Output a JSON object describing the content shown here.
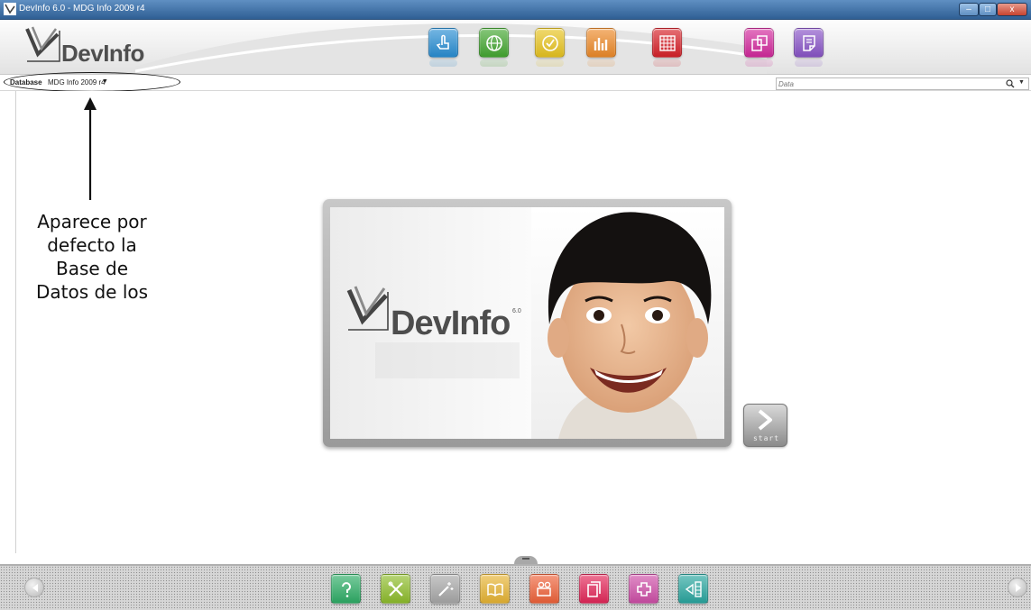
{
  "window": {
    "title": "DevInfo 6.0 - MDG Info 2009 r4",
    "minimize": "–",
    "maximize": "□",
    "close": "x"
  },
  "app": {
    "logo_text": "DevInfo"
  },
  "toolbar": {
    "buttons": [
      {
        "icon": "hand-pointer-icon",
        "color": "#2a8fd4"
      },
      {
        "icon": "globe-icon",
        "color": "#45a832"
      },
      {
        "icon": "check-circle-icon",
        "color": "#e9c521"
      },
      {
        "icon": "bar-chart-icon",
        "color": "#ee8b2a"
      },
      {
        "icon": "grid-table-icon",
        "color": "#d8222a"
      },
      {
        "icon": "layers-icon",
        "color": "#d42a9e"
      },
      {
        "icon": "document-edit-icon",
        "color": "#8a55c9"
      }
    ]
  },
  "database": {
    "label": "Database",
    "value": "MDG Info 2009 r4"
  },
  "search": {
    "placeholder": "Data"
  },
  "annotation": {
    "lines": [
      "Aparece por",
      "defecto la",
      "Base de",
      "Datos de los"
    ]
  },
  "splash": {
    "logo_text": "DevInfo",
    "version": "6.0"
  },
  "start_button": {
    "label": "start"
  },
  "dock": {
    "buttons": [
      {
        "icon": "help-icon",
        "color": "#2fae67"
      },
      {
        "icon": "tools-icon",
        "color": "#8fbe2c"
      },
      {
        "icon": "magic-wand-icon",
        "color": "#a9a9a9"
      },
      {
        "icon": "book-icon",
        "color": "#e8b534"
      },
      {
        "icon": "video-camera-icon",
        "color": "#f0633a"
      },
      {
        "icon": "pages-icon",
        "color": "#e4285a"
      },
      {
        "icon": "puzzle-icon",
        "color": "#cf4fa8"
      },
      {
        "icon": "share-list-icon",
        "color": "#2aa7a0"
      }
    ]
  },
  "colors": {
    "titlebar": "#3e6fa6",
    "toolbar_bg": "#eeeeee",
    "dock_bg": "#d6d6d6"
  }
}
